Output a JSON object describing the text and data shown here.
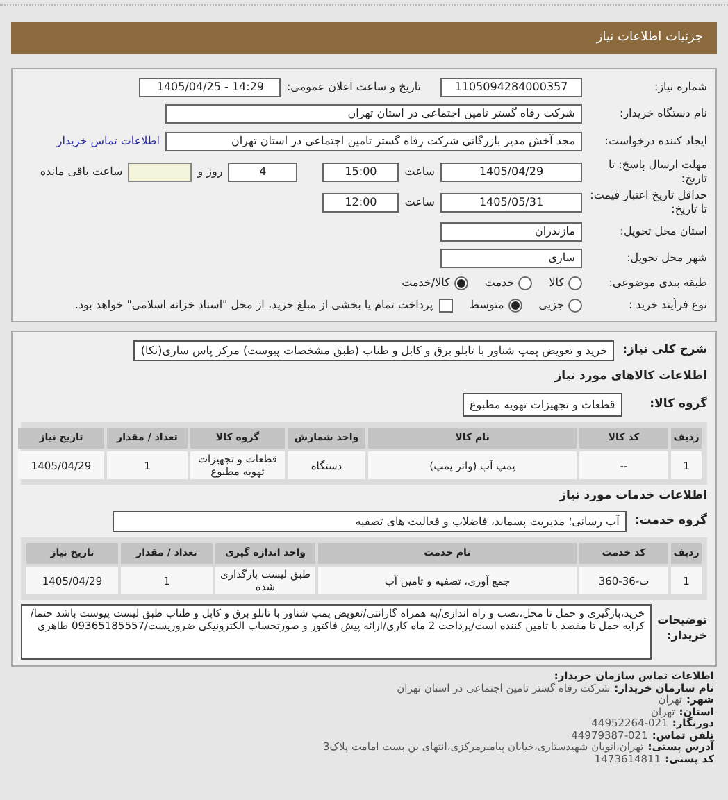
{
  "header": {
    "title": "جزئیات اطلاعات نیاز"
  },
  "details": {
    "need_number": {
      "label": "شماره نیاز:",
      "value": "1105094284000357"
    },
    "announce": {
      "label": "تاریخ و ساعت اعلان عمومی:",
      "value": "1405/04/25 - 14:29"
    },
    "buyer_org": {
      "label": "نام دستگاه خریدار:",
      "value": "شرکت رفاه گستر تامین اجتماعی در استان تهران"
    },
    "requester": {
      "label": "ایجاد کننده درخواست:",
      "value": "مجد آخش مدیر بازرگانی شرکت رفاه گستر تامین اجتماعی در استان تهران",
      "contact_link": "اطلاعات تماس خریدار"
    },
    "deadline": {
      "label": "مهلت ارسال پاسخ: تا تاریخ:",
      "date": "1405/04/29",
      "time_label": "ساعت",
      "time": "15:00",
      "days": "4",
      "days_label": "روز و",
      "remaining_label": "ساعت باقی مانده"
    },
    "validity": {
      "label": "حداقل تاریخ اعتبار قیمت: تا تاریخ:",
      "date": "1405/05/31",
      "time_label": "ساعت",
      "time": "12:00"
    },
    "province": {
      "label": "استان محل تحویل:",
      "value": "مازندران"
    },
    "city": {
      "label": "شهر محل تحویل:",
      "value": "ساری"
    },
    "category": {
      "label": "طبقه بندی موضوعی:",
      "options": [
        {
          "label": "کالا",
          "selected": false
        },
        {
          "label": "خدمت",
          "selected": false
        },
        {
          "label": "کالا/خدمت",
          "selected": true
        }
      ]
    },
    "process": {
      "label": "نوع فرآیند خرید :",
      "options": [
        {
          "label": "جزیی",
          "selected": false
        },
        {
          "label": "متوسط",
          "selected": true
        }
      ],
      "treasury": {
        "label": "پرداخت تمام یا بخشی از مبلغ خرید، از محل \"اسناد خزانه اسلامی\" خواهد بود.",
        "checked": false
      }
    }
  },
  "need": {
    "description": {
      "label": "شرح کلی نیاز:",
      "value": "خرید و تعویض پمپ شناور با تابلو برق و کابل و طناب (طبق مشخصات پیوست) مرکز پاس ساری(نکا)"
    },
    "goods_title": "اطلاعات کالاهای مورد نیاز",
    "goods_group": {
      "label": "گروه کالا:",
      "value": "قطعات و تجهیزات تهویه مطبوع"
    },
    "goods_table": {
      "columns": [
        "ردیف",
        "کد کالا",
        "نام کالا",
        "واحد شمارش",
        "گروه کالا",
        "تعداد / مقدار",
        "تاریخ نیاز"
      ],
      "rows": [
        [
          "1",
          "--",
          "پمپ آب (واتر پمپ)",
          "دستگاه",
          "قطعات و تجهیزات تهویه مطبوع",
          "1",
          "1405/04/29"
        ]
      ]
    },
    "services_title": "اطلاعات خدمات مورد نیاز",
    "service_group": {
      "label": "گروه خدمت:",
      "value": "آب رسانی؛ مدیریت پسماند، فاضلاب و فعالیت های تصفیه"
    },
    "services_table": {
      "columns": [
        "ردیف",
        "کد خدمت",
        "نام خدمت",
        "واحد اندازه گیری",
        "تعداد / مقدار",
        "تاریخ نیاز"
      ],
      "rows": [
        [
          "1",
          "ت-36-360",
          "جمع آوری، تصفیه و تامین آب",
          "طبق لیست بارگذاری شده",
          "1",
          "1405/04/29"
        ]
      ]
    },
    "notes": {
      "label": "توضیحات خریدار:",
      "value": "خرید،بارگیری و حمل تا محل،نصب و راه اندازی/به همراه گارانتی/تعویض پمپ شناور با تابلو برق و کابل و طناب طبق لیست پیوست باشد حتما/کرایه حمل تا مقصد با تامین کننده است/پرداخت 2 ماه کاری/ارائه پیش فاکتور و صورتحساب الکترونیکی ضروریست/09365185557 طاهری"
    }
  },
  "contact": {
    "title": "اطلاعات تماس سازمان خریدار:",
    "lines": [
      {
        "label": "نام سازمان خریدار:",
        "value": "شرکت رفاه گستر تامین اجتماعی در استان تهران"
      },
      {
        "label": "شهر:",
        "value": "تهران"
      },
      {
        "label": "استان:",
        "value": "تهران"
      },
      {
        "label": "دورنگار:",
        "value": "44952264-021"
      },
      {
        "label": "تلفن تماس:",
        "value": "44979387-021"
      },
      {
        "label": "آدرس پستی:",
        "value": "تهران،اتوبان شهیدستاری،خیابان پیامبرمرکزی،انتهای بن بست امامت پلاک3"
      },
      {
        "label": "کد پستی:",
        "value": "1473614811"
      }
    ]
  }
}
